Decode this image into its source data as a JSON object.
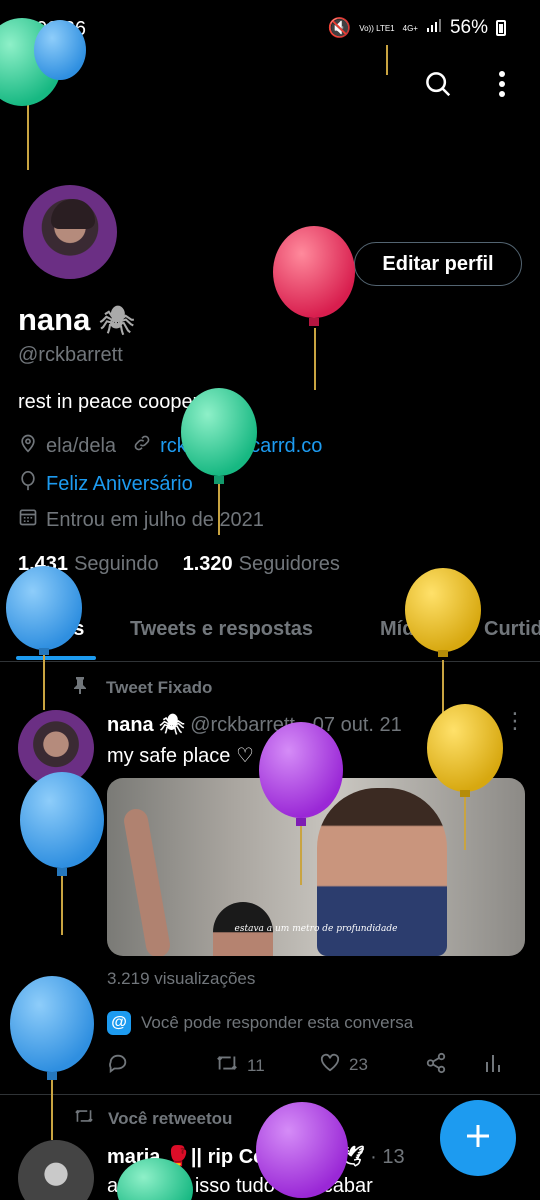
{
  "status_bar": {
    "time": "00:26",
    "volte": "Vo)) LTE1",
    "network": "4G+",
    "battery": "56%"
  },
  "profile": {
    "edit_label": "Editar perfil",
    "name": "nana",
    "name_emoji": "🕷",
    "handle": "@rckbarrett",
    "bio": "rest in peace cooper 🕊",
    "pronouns": "ela/dela",
    "website": "rckbarrett.carrd.co",
    "birthday": "Feliz Aniversário",
    "joined": "Entrou em julho de 2021",
    "following_count": "1.431",
    "following_label": "Seguindo",
    "followers_count": "1.320",
    "followers_label": "Seguidores"
  },
  "tabs": [
    {
      "label": "Tweets",
      "active": true
    },
    {
      "label": "Tweets e respostas",
      "active": false
    },
    {
      "label": "Mídia",
      "active": false
    },
    {
      "label": "Curtidas",
      "active": false
    }
  ],
  "pinned_tweet": {
    "pinned_label": "Tweet Fixado",
    "author": "nana 🕷",
    "handle": "@rckbarrett",
    "date": "07 out. 21",
    "text": "my safe place ♡",
    "media_caption": "estava a um metro de profundidade",
    "views": "3.219 visualizações",
    "reply_note": "Você pode responder esta conversa",
    "retweets": "11",
    "likes": "23"
  },
  "retweet": {
    "label": "Você retweetou",
    "author": "maria 🥊|| rip Cooper 🖤🕊",
    "date": "13",
    "text": "acho que isso tudo vai acabar"
  },
  "colors": {
    "accent": "#1d9bf0",
    "muted": "#71767b",
    "background": "#000000"
  },
  "icons": [
    "back-arrow-icon",
    "search-icon",
    "more-vertical-icon",
    "location-icon",
    "link-icon",
    "balloon-icon",
    "calendar-icon",
    "pin-icon",
    "reply-icon",
    "retweet-icon",
    "like-icon",
    "share-icon",
    "analytics-icon",
    "compose-icon"
  ]
}
